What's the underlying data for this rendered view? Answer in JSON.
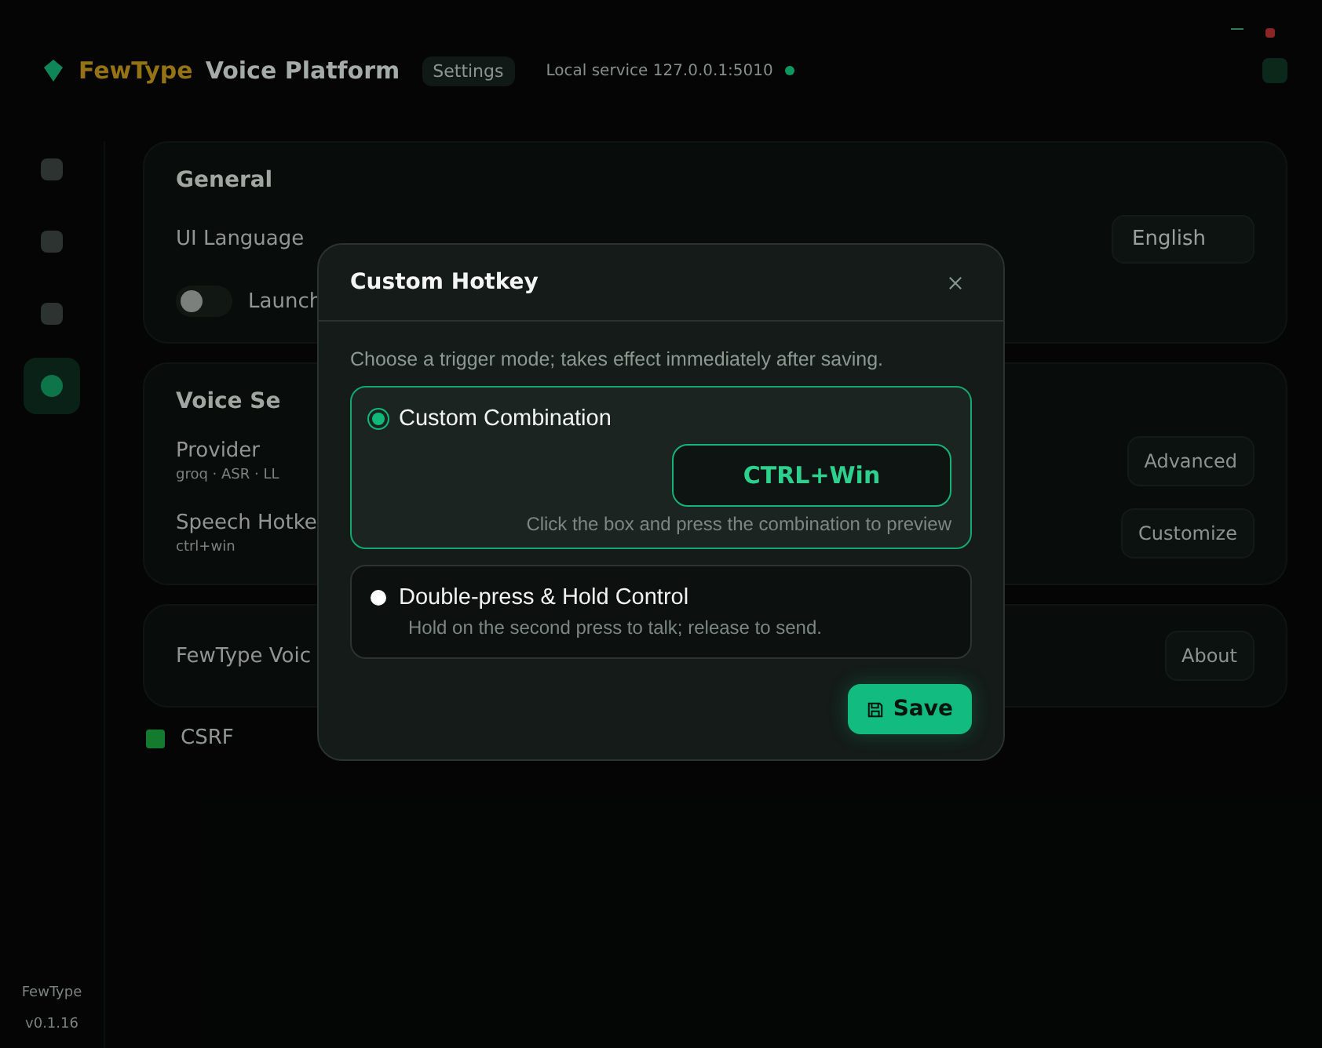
{
  "app": {
    "brand_accent": "FewType",
    "brand_rest": "Voice Platform",
    "page_badge": "Settings",
    "service_status": "Local service 127.0.0.1:5010",
    "service_online": true
  },
  "sidebar": {
    "items": [
      {
        "selected": false
      },
      {
        "selected": false
      },
      {
        "selected": false
      },
      {
        "selected": true
      }
    ],
    "footer_name": "FewType",
    "footer_version": "v0.1.16"
  },
  "general": {
    "title": "General",
    "language_label": "UI Language",
    "language_value": "English",
    "launch_label": "Launch",
    "launch_on": false
  },
  "voice": {
    "title": "Voice Se",
    "provider_label": "Provider",
    "provider_value": "groq · ASR · LL",
    "advanced_button": "Advanced",
    "hotkey_label": "Speech Hotke",
    "hotkey_value": "ctrl+win",
    "customize_button": "Customize"
  },
  "about": {
    "text": "FewType Voic",
    "button": "About"
  },
  "csrf": {
    "label": "CSRF",
    "checked": true
  },
  "dialog": {
    "title": "Custom Hotkey",
    "description": "Choose a trigger mode; takes effect immediately after saving.",
    "options": [
      {
        "kind": "combo",
        "label": "Custom Combination",
        "selected": true,
        "key_value": "CTRL+Win",
        "hint": "Click the box and press the combination to preview"
      },
      {
        "kind": "double",
        "label": "Double-press & Hold Control",
        "selected": false,
        "hint": "Hold on the second press to talk; release to send."
      }
    ],
    "save_button": "Save"
  }
}
